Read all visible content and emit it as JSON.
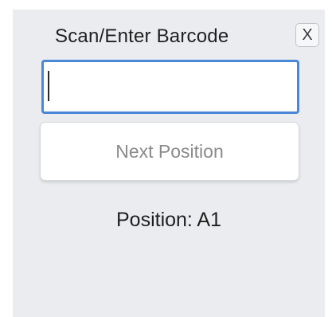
{
  "dialog": {
    "title": "Scan/Enter Barcode",
    "close_label": "X",
    "barcode_input": {
      "value": "",
      "placeholder": ""
    },
    "next_button_label": "Next Position",
    "position_text": "Position: A1"
  },
  "colors": {
    "panel_background": "#eaecef",
    "input_focus_border": "#4a87d6",
    "disabled_text": "#8a8a8a"
  }
}
